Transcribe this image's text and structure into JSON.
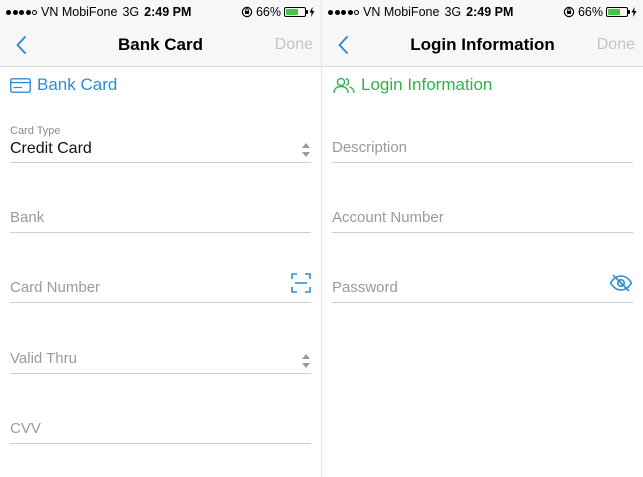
{
  "status_bar": {
    "carrier": "VN MobiFone",
    "network": "3G",
    "time": "2:49 PM",
    "battery_percent": "66%",
    "battery_level": 0.66
  },
  "left_screen": {
    "nav": {
      "title": "Bank Card",
      "done_label": "Done"
    },
    "section_title": "Bank Card",
    "card_type": {
      "label": "Card Type",
      "value": "Credit Card"
    },
    "fields": {
      "bank": "Bank",
      "card_number": "Card Number",
      "valid_thru": "Valid Thru",
      "cvv": "CVV"
    }
  },
  "right_screen": {
    "nav": {
      "title": "Login Information",
      "done_label": "Done"
    },
    "section_title": "Login Information",
    "fields": {
      "description": "Description",
      "account_number": "Account Number",
      "password": "Password"
    }
  },
  "colors": {
    "accent_blue": "#2a8fd6",
    "accent_green": "#2cb54a",
    "battery_green": "#3cc93c",
    "placeholder_gray": "#9a9a9a"
  },
  "icons": {
    "back": "chevron-left-icon",
    "bank_card": "credit-card-icon",
    "login": "users-icon",
    "scan": "scan-icon",
    "visibility": "eye-slash-icon",
    "picker": "up-down-arrows-icon"
  }
}
